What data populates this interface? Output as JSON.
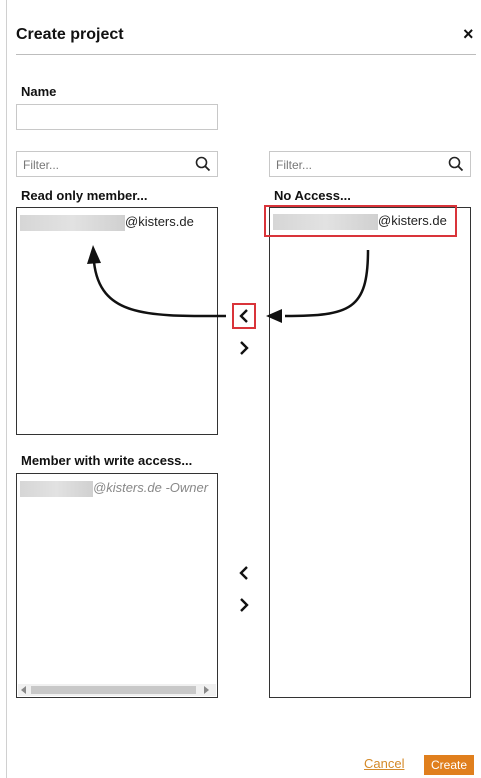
{
  "dialog": {
    "title": "Create project",
    "close_label": "×"
  },
  "name_field": {
    "label": "Name",
    "value": "",
    "placeholder": ""
  },
  "left_filter": {
    "placeholder": "Filter..."
  },
  "right_filter": {
    "placeholder": "Filter..."
  },
  "read_only": {
    "header": "Read only member...",
    "entries": [
      {
        "suffix": "@kisters.de"
      }
    ]
  },
  "no_access": {
    "header": "No Access...",
    "entries": [
      {
        "suffix": "@kisters.de"
      }
    ]
  },
  "write_access": {
    "header": "Member with write access...",
    "entries": [
      {
        "suffix": "@kisters.de -Owner"
      }
    ]
  },
  "transfer": {
    "move_left_glyph": "‹",
    "move_right_glyph": "›"
  },
  "footer": {
    "cancel_label": "Cancel",
    "create_label": "Create"
  },
  "colors": {
    "accent": "#e07f1d",
    "annotation_red": "#d9343a"
  },
  "icons": [
    "search-icon",
    "close-icon",
    "chevron-left-icon",
    "chevron-right-icon"
  ]
}
